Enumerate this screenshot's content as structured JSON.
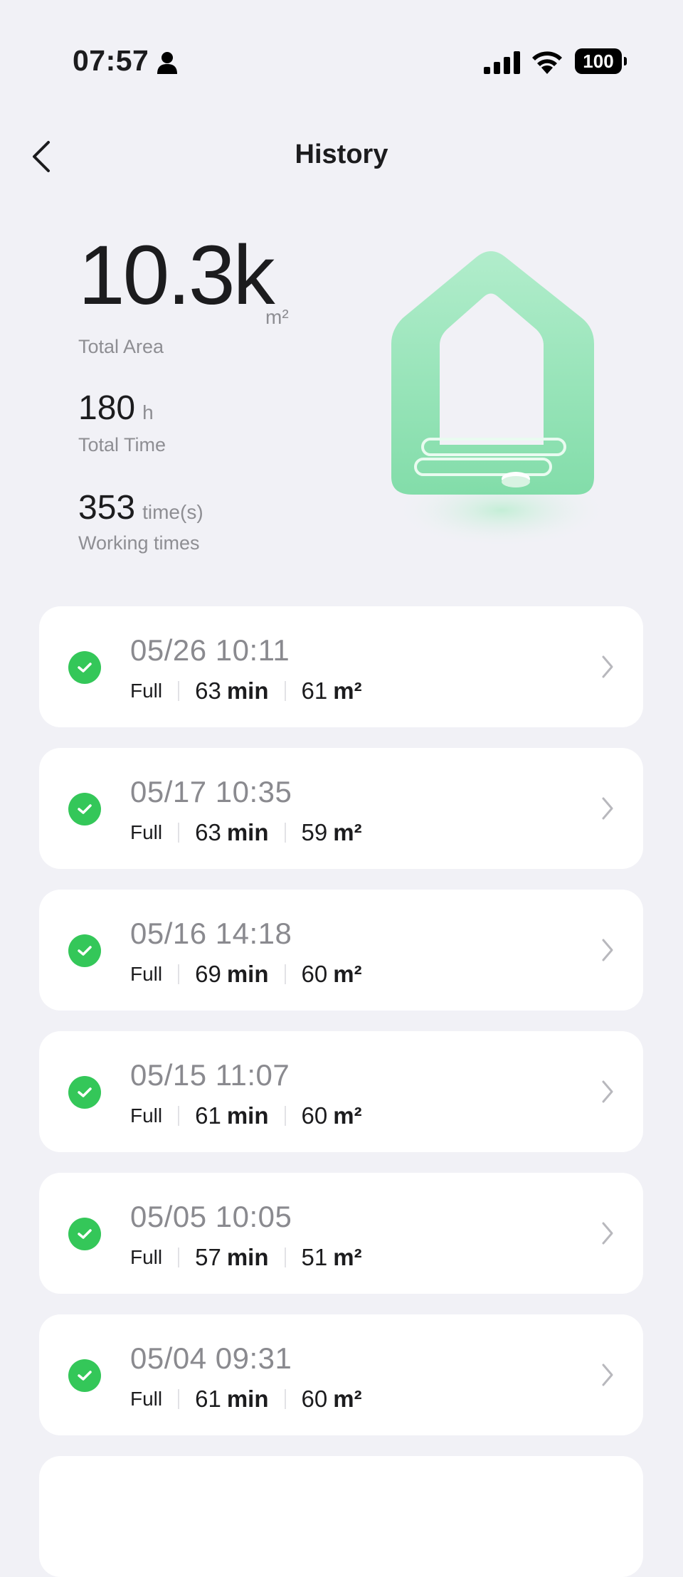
{
  "status_bar": {
    "time": "07:57",
    "battery": "100"
  },
  "header": {
    "title": "History"
  },
  "stats": {
    "total_area_value": "10.3k",
    "total_area_unit": "m²",
    "total_area_label": "Total Area",
    "total_time_value": "180",
    "total_time_unit": "h",
    "total_time_label": "Total Time",
    "working_times_value": "353",
    "working_times_unit": "time(s)",
    "working_times_label": "Working times"
  },
  "records": [
    {
      "date": "05/26  10:11",
      "mode": "Full",
      "duration": "63",
      "duration_unit": "min",
      "area": "61",
      "area_unit": "m²"
    },
    {
      "date": "05/17  10:35",
      "mode": "Full",
      "duration": "63",
      "duration_unit": "min",
      "area": "59",
      "area_unit": "m²"
    },
    {
      "date": "05/16  14:18",
      "mode": "Full",
      "duration": "69",
      "duration_unit": "min",
      "area": "60",
      "area_unit": "m²"
    },
    {
      "date": "05/15  11:07",
      "mode": "Full",
      "duration": "61",
      "duration_unit": "min",
      "area": "60",
      "area_unit": "m²"
    },
    {
      "date": "05/05  10:05",
      "mode": "Full",
      "duration": "57",
      "duration_unit": "min",
      "area": "51",
      "area_unit": "m²"
    },
    {
      "date": "05/04  09:31",
      "mode": "Full",
      "duration": "61",
      "duration_unit": "min",
      "area": "60",
      "area_unit": "m²"
    }
  ],
  "colors": {
    "success": "#34c759",
    "illustration": "#7fe0a8",
    "background": "#f1f1f6"
  },
  "icons": {
    "back": "chevron-left-icon",
    "status": "check-circle-icon",
    "row": "chevron-right-icon"
  }
}
